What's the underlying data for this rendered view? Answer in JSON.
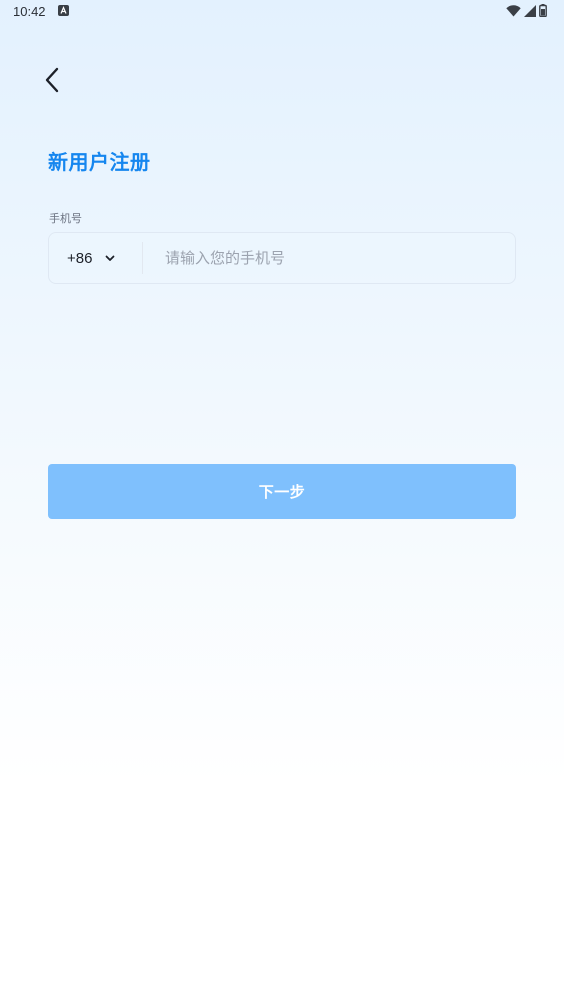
{
  "status_bar": {
    "time": "10:42",
    "notification_icon": "android-notification-icon",
    "wifi_icon": "wifi-icon",
    "signal_icon": "cellular-signal-icon",
    "battery_icon": "battery-icon"
  },
  "header": {
    "back_icon": "chevron-left-icon"
  },
  "page": {
    "title": "新用户注册"
  },
  "phone_field": {
    "label": "手机号",
    "country_code": "+86",
    "placeholder": "请输入您的手机号",
    "value": ""
  },
  "actions": {
    "next_label": "下一步"
  },
  "colors": {
    "accent": "#1586ef",
    "button_disabled": "#7fc0fd"
  }
}
